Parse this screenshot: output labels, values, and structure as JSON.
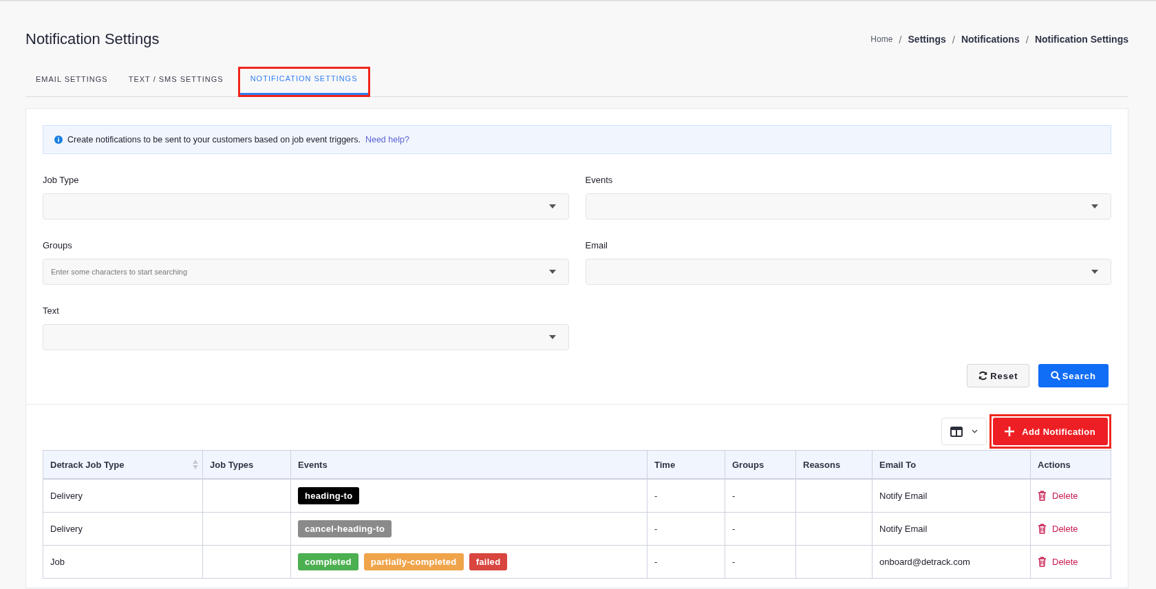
{
  "page_title": "Notification Settings",
  "breadcrumb": [
    {
      "label": "Home",
      "current": false
    },
    {
      "separator": "/",
      "label": "Settings",
      "current": true
    },
    {
      "separator": "/",
      "label": "Notifications",
      "current": true
    },
    {
      "separator": "/",
      "label": "Notification Settings",
      "current": true
    }
  ],
  "tabs": [
    {
      "label": "EMAIL SETTINGS",
      "selected": false,
      "highlighted": false
    },
    {
      "label": "TEXT / SMS SETTINGS",
      "selected": false,
      "highlighted": false
    },
    {
      "label": "NOTIFICATION SETTINGS",
      "selected": true,
      "highlighted": true
    }
  ],
  "info": {
    "text": "Create notifications to be sent to your customers based on job event triggers.",
    "link": "Need help?"
  },
  "filters": [
    {
      "label": "Job Type"
    },
    {
      "label": "Events"
    },
    {
      "label": "Groups",
      "placeholder": "Enter some characters to start searching"
    },
    {
      "label": "Email"
    },
    {
      "label": "Text"
    }
  ],
  "filter_buttons": [
    {
      "kind": "reset",
      "label": "Reset"
    },
    {
      "kind": "search",
      "label": "Search"
    }
  ],
  "add_button": {
    "label": "Add Notification",
    "highlighted": true
  },
  "table": {
    "columns": [
      {
        "label": "Detrack Job Type",
        "sortable": true
      },
      {
        "label": "Job Types",
        "sortable": false
      },
      {
        "label": "Events",
        "sortable": false
      },
      {
        "label": "Time",
        "sortable": false
      },
      {
        "label": "Groups",
        "sortable": false
      },
      {
        "label": "Reasons",
        "sortable": false
      },
      {
        "label": "Email To",
        "sortable": false
      },
      {
        "label": "Actions",
        "sortable": false
      }
    ],
    "rows": [
      {
        "job_type": "Delivery",
        "events": [
          {
            "label": "heading-to",
            "color": "#000000"
          }
        ],
        "time": "-",
        "groups": "-",
        "email_to": "Notify Email",
        "action": "Delete"
      },
      {
        "job_type": "Delivery",
        "events": [
          {
            "label": "cancel-heading-to",
            "color": "#8a8a8a"
          }
        ],
        "time": "-",
        "groups": "-",
        "email_to": "Notify Email",
        "action": "Delete"
      },
      {
        "job_type": "Job",
        "events": [
          {
            "label": "completed",
            "color": "#4caf50"
          },
          {
            "label": "partially-completed",
            "color": "#f0a44a"
          },
          {
            "label": "failed",
            "color": "#d9453f"
          }
        ],
        "time": "-",
        "groups": "-",
        "email_to": "onboard@detrack.com",
        "action": "Delete"
      }
    ]
  }
}
